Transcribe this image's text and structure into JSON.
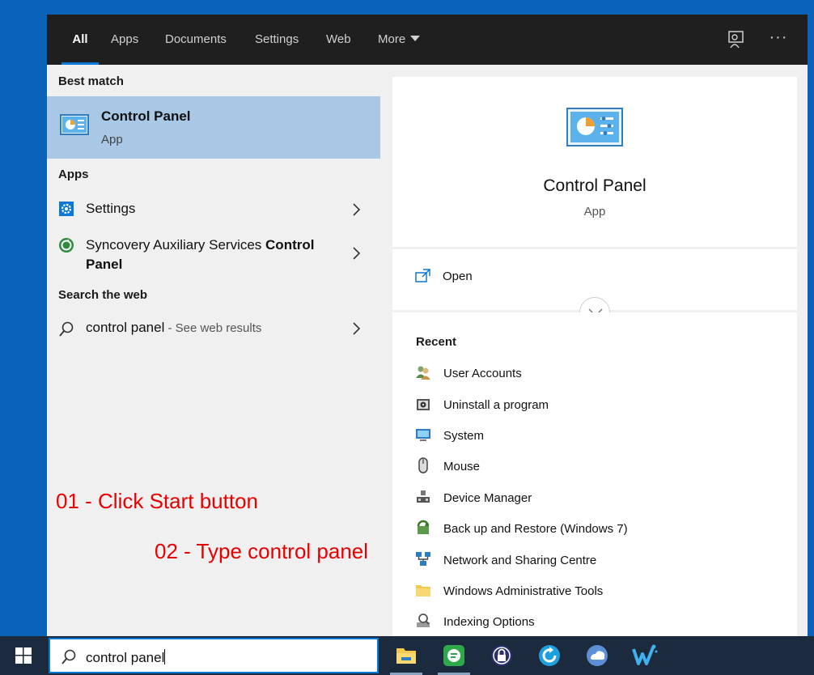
{
  "tabs": {
    "all": "All",
    "apps": "Apps",
    "documents": "Documents",
    "settings": "Settings",
    "web": "Web",
    "more": "More",
    "more_options": "···"
  },
  "left": {
    "best_match_label": "Best match",
    "best_match": {
      "title": "Control Panel",
      "subtitle": "App",
      "icon": "control-panel-icon"
    },
    "apps_label": "Apps",
    "apps": [
      {
        "label": "Settings",
        "icon": "gear-icon"
      },
      {
        "label_prefix": "Syncovery Auxiliary Services ",
        "label_bold": "Control Panel",
        "icon": "syncovery-icon"
      }
    ],
    "web_label": "Search the web",
    "web_result": {
      "query": "control panel",
      "suffix": " - See web results",
      "icon": "search-icon"
    }
  },
  "annotations": {
    "step1": "01 - Click Start button",
    "step2": "02 - Type control panel",
    "color": "#e60000"
  },
  "right": {
    "app_name": "Control Panel",
    "app_type": "App",
    "open_label": "Open",
    "recent_label": "Recent",
    "recent": [
      {
        "label": "User Accounts",
        "icon": "user-accounts-icon"
      },
      {
        "label": "Uninstall a program",
        "icon": "uninstall-icon"
      },
      {
        "label": "System",
        "icon": "system-icon"
      },
      {
        "label": "Mouse",
        "icon": "mouse-icon"
      },
      {
        "label": "Device Manager",
        "icon": "device-manager-icon"
      },
      {
        "label": "Back up and Restore (Windows 7)",
        "icon": "backup-restore-icon"
      },
      {
        "label": "Network and Sharing Centre",
        "icon": "network-icon"
      },
      {
        "label": "Windows Administrative Tools",
        "icon": "folder-icon"
      },
      {
        "label": "Indexing Options",
        "icon": "indexing-icon"
      }
    ]
  },
  "taskbar": {
    "search_value": "control panel",
    "apps": [
      "file-explorer-icon",
      "green-app-icon",
      "lock-app-icon",
      "refresh-app-icon",
      "cloud-app-icon",
      "w-app-icon"
    ]
  },
  "colors": {
    "desktop": "#0a63b6",
    "accent": "#0a78d7",
    "selection": "#a8c8e6",
    "tabbar": "#1f1f1f",
    "taskbar": "#1b2a3c"
  }
}
